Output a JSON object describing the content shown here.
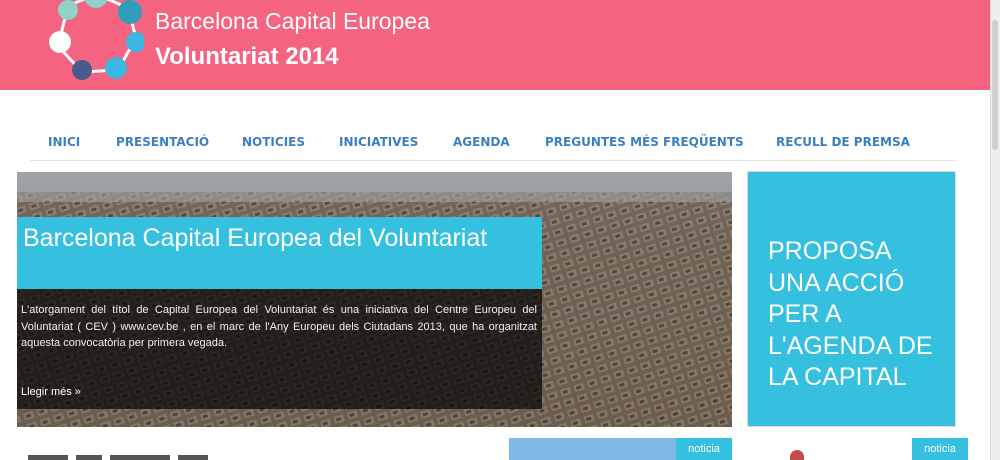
{
  "header": {
    "brand_line1": "Barcelona Capital Europea",
    "brand_line2": "Voluntariat 2014",
    "bg_color": "#f4637f"
  },
  "nav": {
    "items": [
      {
        "label": "INICI"
      },
      {
        "label": "PRESENTACIÓ"
      },
      {
        "label": "NOTICIES"
      },
      {
        "label": "INICIATIVES"
      },
      {
        "label": "AGENDA"
      },
      {
        "label": "PREGUNTES MÉS FREQÜENTS"
      },
      {
        "label": "RECULL DE PREMSA"
      }
    ],
    "color": "#3c7fbf"
  },
  "hero": {
    "title": "Barcelona Capital Europea del Voluntariat",
    "description": "L'atorgament del títol de Capital Europea del Voluntariat és una iniciativa del Centre Europeu del Voluntariat ( CEV ) www.cev.be , en el marc de l'Any Europeu dels Ciutadans 2013, que ha organitzat aquesta convocatòria per primera vegada.",
    "more_link": "Llegir més »"
  },
  "sidebar": {
    "cta": "PROPOSA UNA ACCIÓ PER A L'AGENDA DE LA CAPITAL",
    "color": "#35c0df"
  },
  "cards": [
    {
      "tag": "noticia"
    },
    {
      "tag": "noticia"
    }
  ]
}
